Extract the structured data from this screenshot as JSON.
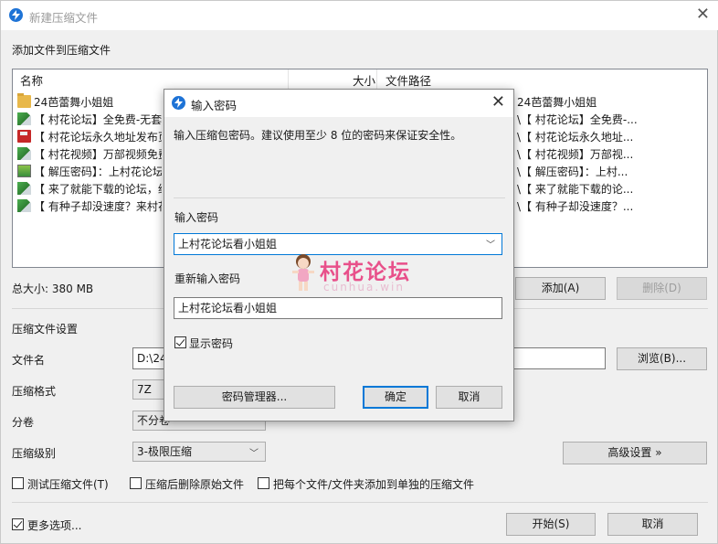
{
  "window": {
    "title": "新建压缩文件",
    "close_glyph": "✕"
  },
  "files": {
    "section_title": "添加文件到压缩文件",
    "columns": {
      "name": "名称",
      "size": "大小",
      "path": "文件路径"
    },
    "rows": [
      {
        "icon": "folder-icon",
        "name": "24芭蕾舞小姐姐",
        "size": "",
        "path": "24芭蕾舞小姐姐"
      },
      {
        "icon": "document-icon",
        "name": "【 村花论坛】全免费-无套路...",
        "size": "",
        "path": "\\【 村花论坛】全免费-..."
      },
      {
        "icon": "disk-icon",
        "name": "【 村花论坛永久地址发布页...",
        "size": "",
        "path": "\\【 村花论坛永久地址..."
      },
      {
        "icon": "document-icon",
        "name": "【 村花视频】万部视频免费...",
        "size": "",
        "path": "\\【 村花视频】万部视..."
      },
      {
        "icon": "image-icon",
        "name": "【 解压密码】：上村花论坛...",
        "size": "",
        "path": "\\【 解压密码】：上村..."
      },
      {
        "icon": "document-icon",
        "name": "【 来了就能下载的论坛，纯...",
        "size": "",
        "path": "\\【 来了就能下载的论..."
      },
      {
        "icon": "document-icon",
        "name": "【 有种子却没速度？来村花...",
        "size": "",
        "path": "\\【 有种子却没速度？..."
      }
    ],
    "total_size": "总大小: 380 MB",
    "add_button": "添加(A)",
    "delete_button": "删除(D)"
  },
  "settings": {
    "section_title": "压缩文件设置",
    "filename_label": "文件名",
    "filename_value": "D:\\24",
    "browse_button": "浏览(B)...",
    "format_label": "压缩格式",
    "format_value": "7Z",
    "split_label": "分卷",
    "split_value": "不分卷",
    "level_label": "压缩级别",
    "level_value": "3-极限压缩",
    "advanced_button": "高级设置 »",
    "options": [
      {
        "label": "测试压缩文件(T)",
        "checked": false
      },
      {
        "label": "压缩后删除原始文件",
        "checked": false
      },
      {
        "label": "把每个文件/文件夹添加到单独的压缩文件",
        "checked": false
      }
    ],
    "more_options": {
      "label": "更多选项...",
      "checked": true
    },
    "start_button": "开始(S)",
    "cancel_button": "取消"
  },
  "password_dialog": {
    "title": "输入密码",
    "hint": "输入压缩包密码。建议使用至少 8 位的密码来保证安全性。",
    "password_label": "输入密码",
    "password_value": "上村花论坛看小姐姐",
    "confirm_label": "重新输入密码",
    "confirm_value": "上村花论坛看小姐姐",
    "show_password": {
      "label": "显示密码",
      "checked": true
    },
    "manager_button": "密码管理器...",
    "ok_button": "确定",
    "cancel_button": "取消"
  },
  "watermark": {
    "text": "村花论坛",
    "url": "cunhua.win"
  }
}
